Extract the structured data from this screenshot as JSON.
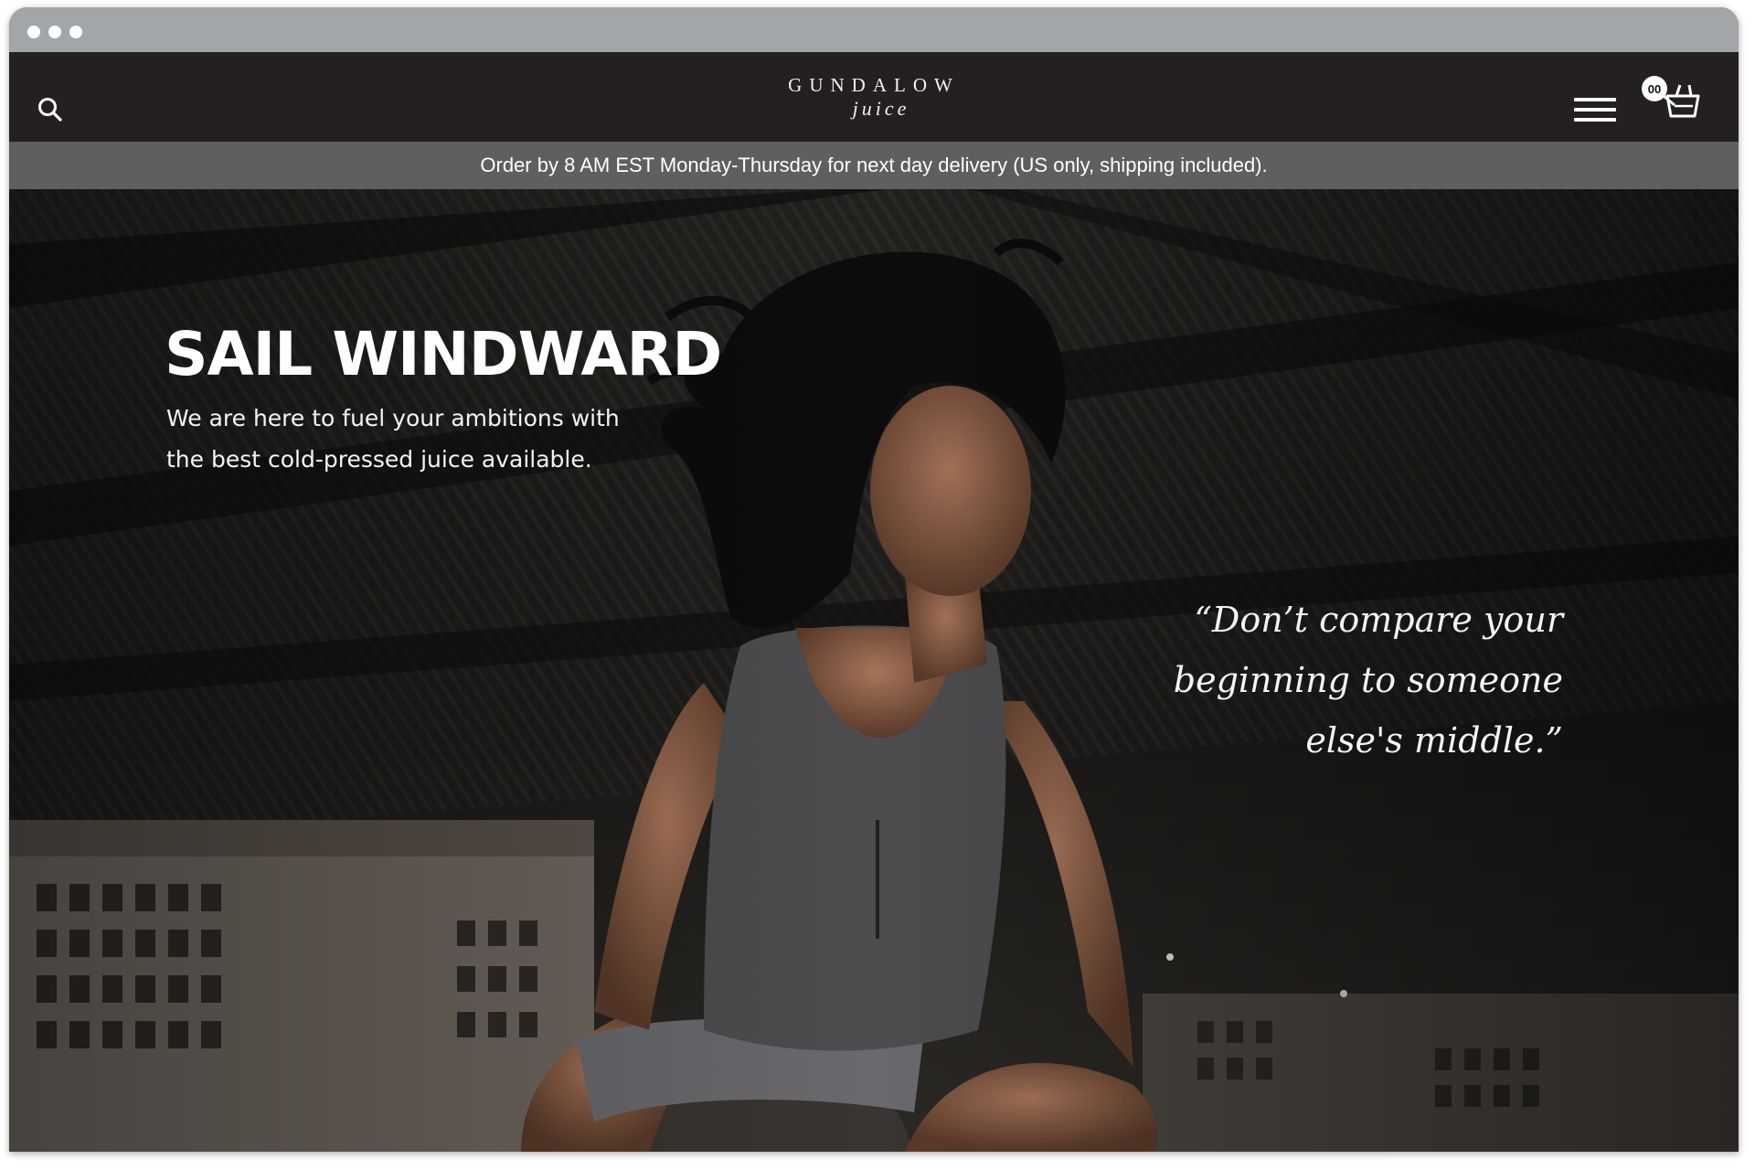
{
  "header": {
    "logo_main": "GUNDALOW",
    "logo_sub": "juice",
    "cart_count": "00"
  },
  "announcement": {
    "text": "Order by 8 AM EST Monday-Thursday for next day delivery (US only, shipping included)."
  },
  "hero": {
    "title": "SAIL WINDWARD",
    "subtitle": "We are here to fuel your ambitions with the best cold-pressed juice available.",
    "quote": "“Don’t compare your beginning to someone else's middle.”"
  },
  "icons": {
    "search": "search-icon",
    "menu": "hamburger-menu-icon",
    "cart": "shopping-basket-icon"
  },
  "colors": {
    "header_bg": "#242021",
    "announcement_bg": "#5d5f61",
    "chrome_bar": "#a3a6a8"
  }
}
